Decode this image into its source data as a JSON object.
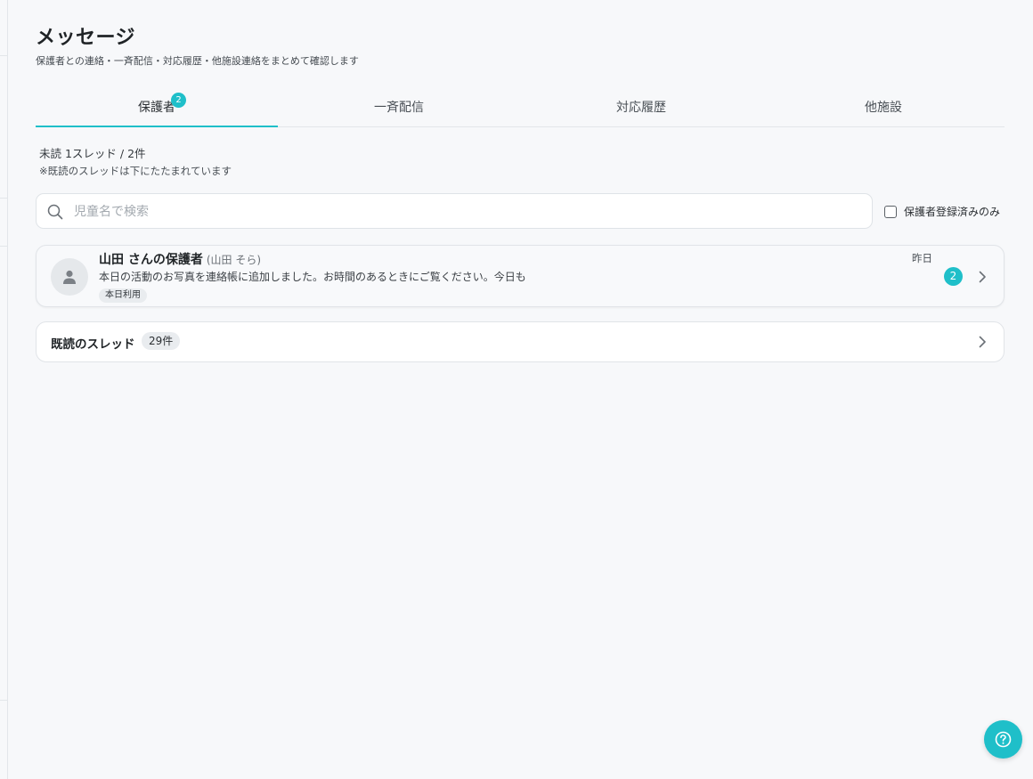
{
  "header": {
    "title": "メッセージ",
    "subtitle": "保護者との連絡・一斉配信・対応履歴・他施設連絡をまとめて確認します"
  },
  "tabs": [
    {
      "label": "保護者",
      "badge": "2",
      "active": true
    },
    {
      "label": "一斉配信",
      "active": false
    },
    {
      "label": "対応履歴",
      "active": false
    },
    {
      "label": "他施設",
      "active": false
    }
  ],
  "summary": {
    "unread": "未読 1スレッド / 2件",
    "note": "※既読のスレッドは下にたたまれています"
  },
  "search": {
    "placeholder": "児童名で検索",
    "value": "",
    "icon": "search-icon"
  },
  "filter": {
    "label": "保護者登録済みのみ",
    "checked": false
  },
  "thread": {
    "name": "山田 さんの保護者",
    "child": "(山田 そら)",
    "preview": "本日の活動のお写真を連絡帳に追加しました。お時間のあるときにご覧ください。今日も",
    "tag": "本日利用",
    "time": "昨日",
    "unread_count": "2",
    "icon": "person-icon"
  },
  "read_threads": {
    "label": "既読のスレッド",
    "count": "29件"
  },
  "help": {
    "icon": "question-circle-icon"
  },
  "colors": {
    "accent": "#1fbfc9",
    "background": "#f7f8fa"
  }
}
